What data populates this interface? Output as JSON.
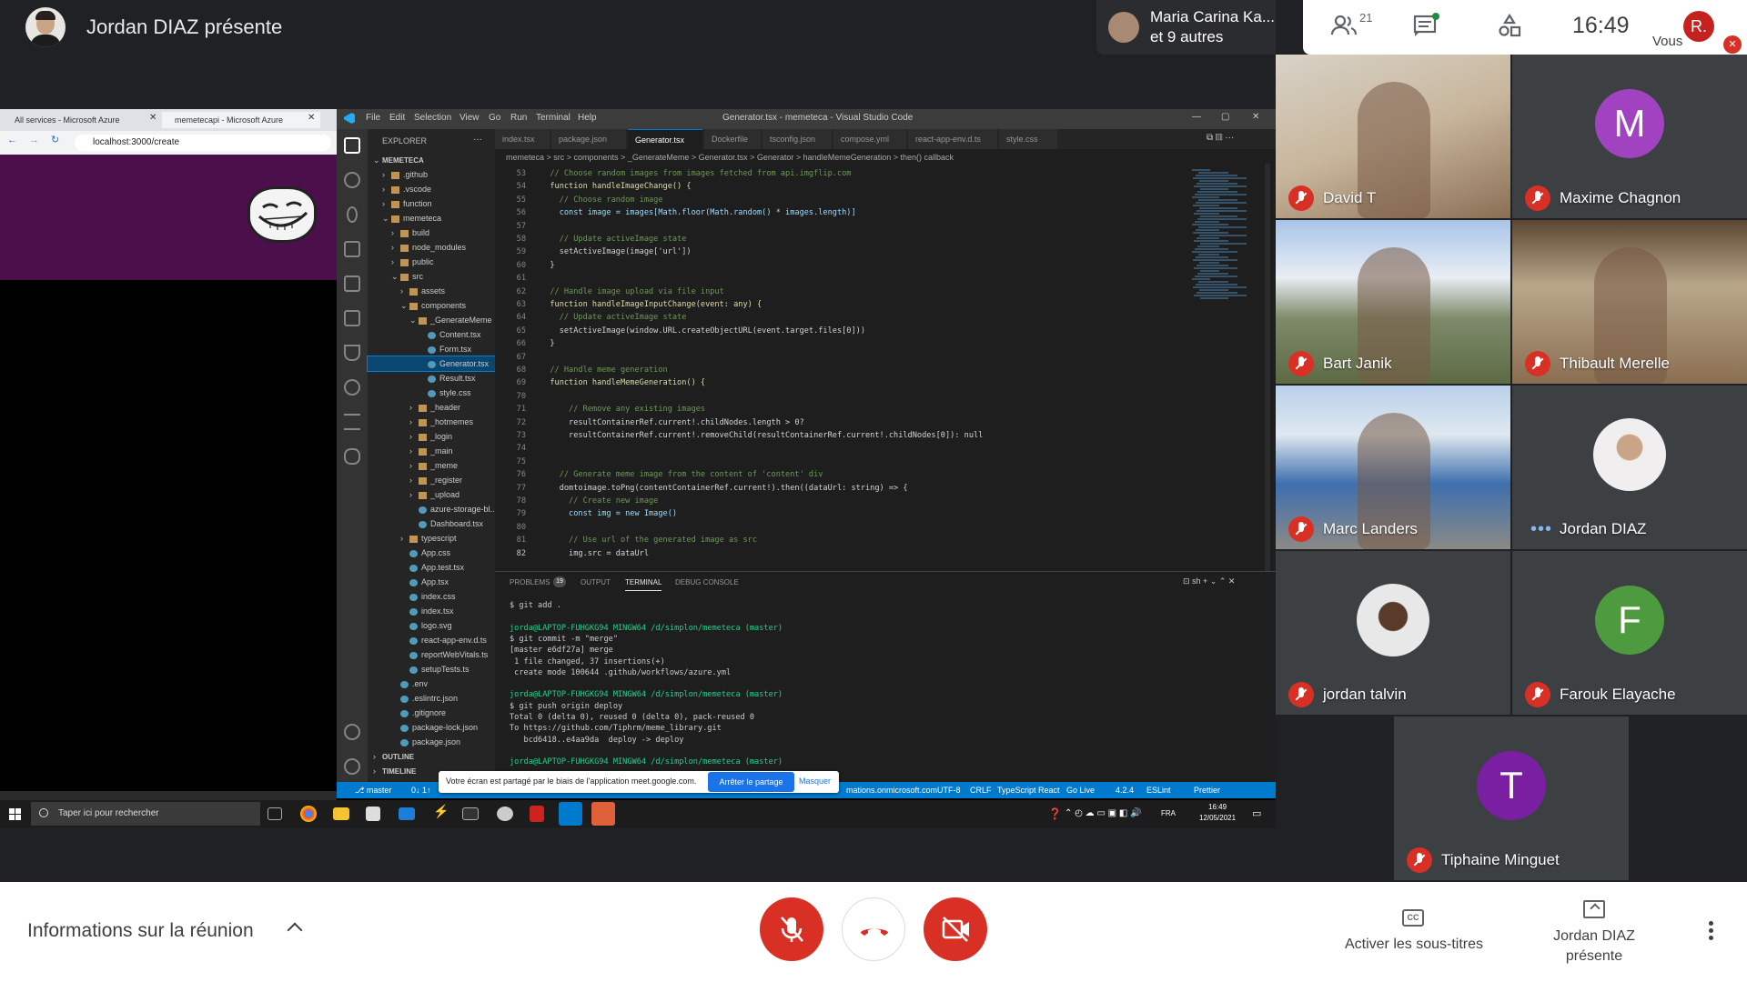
{
  "presenter": {
    "title": "Jordan DIAZ présente"
  },
  "notification": {
    "name": "Maria Carina Ka...",
    "others": "et 9 autres"
  },
  "top_controls": {
    "people_count": "21",
    "clock": "16:49",
    "self_initial": "R.",
    "self_label": "Vous"
  },
  "browser": {
    "tabs": [
      "All services - Microsoft Azure",
      "memetecapi - Microsoft Azure"
    ],
    "address": "localhost:3000/create"
  },
  "vscode": {
    "menu": [
      "File",
      "Edit",
      "Selection",
      "View",
      "Go",
      "Run",
      "Terminal",
      "Help"
    ],
    "window_title": "Generator.tsx - memeteca - Visual Studio Code",
    "explorer_label": "EXPLORER",
    "tree": [
      {
        "label": "MEMETECA",
        "depth": 0,
        "type": "root"
      },
      {
        "label": ".github",
        "depth": 1,
        "type": "folder"
      },
      {
        "label": ".vscode",
        "depth": 1,
        "type": "folder"
      },
      {
        "label": "function",
        "depth": 1,
        "type": "folder"
      },
      {
        "label": "memeteca",
        "depth": 1,
        "type": "folder-open"
      },
      {
        "label": "build",
        "depth": 2,
        "type": "folder"
      },
      {
        "label": "node_modules",
        "depth": 2,
        "type": "folder"
      },
      {
        "label": "public",
        "depth": 2,
        "type": "folder"
      },
      {
        "label": "src",
        "depth": 2,
        "type": "folder-open"
      },
      {
        "label": "assets",
        "depth": 3,
        "type": "folder"
      },
      {
        "label": "components",
        "depth": 3,
        "type": "folder-open"
      },
      {
        "label": "_GenerateMeme",
        "depth": 4,
        "type": "folder-open"
      },
      {
        "label": "Content.tsx",
        "depth": 5,
        "type": "file"
      },
      {
        "label": "Form.tsx",
        "depth": 5,
        "type": "file"
      },
      {
        "label": "Generator.tsx",
        "depth": 5,
        "type": "file-selected"
      },
      {
        "label": "Result.tsx",
        "depth": 5,
        "type": "file"
      },
      {
        "label": "style.css",
        "depth": 5,
        "type": "file"
      },
      {
        "label": "_header",
        "depth": 4,
        "type": "folder"
      },
      {
        "label": "_hotmemes",
        "depth": 4,
        "type": "folder"
      },
      {
        "label": "_login",
        "depth": 4,
        "type": "folder"
      },
      {
        "label": "_main",
        "depth": 4,
        "type": "folder"
      },
      {
        "label": "_meme",
        "depth": 4,
        "type": "folder"
      },
      {
        "label": "_register",
        "depth": 4,
        "type": "folder"
      },
      {
        "label": "_upload",
        "depth": 4,
        "type": "folder"
      },
      {
        "label": "azure-storage-bl...",
        "depth": 4,
        "type": "file"
      },
      {
        "label": "Dashboard.tsx",
        "depth": 4,
        "type": "file"
      },
      {
        "label": "typescript",
        "depth": 3,
        "type": "folder"
      },
      {
        "label": "App.css",
        "depth": 3,
        "type": "file"
      },
      {
        "label": "App.test.tsx",
        "depth": 3,
        "type": "file"
      },
      {
        "label": "App.tsx",
        "depth": 3,
        "type": "file"
      },
      {
        "label": "index.css",
        "depth": 3,
        "type": "file"
      },
      {
        "label": "index.tsx",
        "depth": 3,
        "type": "file"
      },
      {
        "label": "logo.svg",
        "depth": 3,
        "type": "file"
      },
      {
        "label": "react-app-env.d.ts",
        "depth": 3,
        "type": "file"
      },
      {
        "label": "reportWebVitals.ts",
        "depth": 3,
        "type": "file"
      },
      {
        "label": "setupTests.ts",
        "depth": 3,
        "type": "file"
      },
      {
        "label": ".env",
        "depth": 2,
        "type": "file"
      },
      {
        "label": ".eslintrc.json",
        "depth": 2,
        "type": "file"
      },
      {
        "label": ".gitignore",
        "depth": 2,
        "type": "file"
      },
      {
        "label": "package-lock.json",
        "depth": 2,
        "type": "file"
      },
      {
        "label": "package.json",
        "depth": 2,
        "type": "file"
      },
      {
        "label": "OUTLINE",
        "depth": 0,
        "type": "section"
      },
      {
        "label": "TIMELINE",
        "depth": 0,
        "type": "section"
      }
    ],
    "editor_tabs": [
      "index.tsx",
      "package.json",
      "Generator.tsx",
      "Dockerfile",
      "tsconfig.json",
      "compose.yml",
      "react-app-env.d.ts",
      "style.css"
    ],
    "active_tab": "Generator.tsx",
    "breadcrumb": "memeteca > src > components > _GenerateMeme > Generator.tsx > Generator > handleMemeGeneration > then() callback",
    "code": [
      {
        "n": "53",
        "t": "  // Choose random images from images fetched from api.imgflip.com"
      },
      {
        "n": "54",
        "t": "  function handleImageChange() {"
      },
      {
        "n": "55",
        "t": "    // Choose random image"
      },
      {
        "n": "56",
        "t": "    const image = images[Math.floor(Math.random() * images.length)]"
      },
      {
        "n": "57",
        "t": ""
      },
      {
        "n": "58",
        "t": "    // Update activeImage state"
      },
      {
        "n": "59",
        "t": "    setActiveImage(image['url'])"
      },
      {
        "n": "60",
        "t": "  }"
      },
      {
        "n": "61",
        "t": ""
      },
      {
        "n": "62",
        "t": "  // Handle image upload via file input"
      },
      {
        "n": "63",
        "t": "  function handleImageInputChange(event: any) {"
      },
      {
        "n": "64",
        "t": "    // Update activeImage state"
      },
      {
        "n": "65",
        "t": "    setActiveImage(window.URL.createObjectURL(event.target.files[0]))"
      },
      {
        "n": "66",
        "t": "  }"
      },
      {
        "n": "67",
        "t": ""
      },
      {
        "n": "68",
        "t": "  // Handle meme generation"
      },
      {
        "n": "69",
        "t": "  function handleMemeGeneration() {"
      },
      {
        "n": "70",
        "t": ""
      },
      {
        "n": "71",
        "t": "      // Remove any existing images"
      },
      {
        "n": "72",
        "t": "      resultContainerRef.current!.childNodes.length > 0?"
      },
      {
        "n": "73",
        "t": "      resultContainerRef.current!.removeChild(resultContainerRef.current!.childNodes[0]): null"
      },
      {
        "n": "74",
        "t": ""
      },
      {
        "n": "75",
        "t": ""
      },
      {
        "n": "76",
        "t": "    // Generate meme image from the content of 'content' div"
      },
      {
        "n": "77",
        "t": "    domtoimage.toPng(contentContainerRef.current!).then((dataUrl: string) => {"
      },
      {
        "n": "78",
        "t": "      // Create new image"
      },
      {
        "n": "79",
        "t": "      const img = new Image()"
      },
      {
        "n": "80",
        "t": ""
      },
      {
        "n": "81",
        "t": "      // Use url of the generated image as src"
      },
      {
        "n": "82",
        "t": "      img.src = dataUrl"
      }
    ],
    "panel_tabs": [
      "PROBLEMS",
      "OUTPUT",
      "TERMINAL",
      "DEBUG CONSOLE"
    ],
    "problems_count": "19",
    "active_panel_tab": "TERMINAL",
    "terminal": [
      {
        "t": "$ git add .",
        "k": "cmd"
      },
      {
        "t": "",
        "k": "blank"
      },
      {
        "t": "jorda@LAPTOP-FUHGKG94 MINGW64 /d/simplon/memeteca (master)",
        "k": "prompt"
      },
      {
        "t": "$ git commit -m \"merge\"",
        "k": "cmd"
      },
      {
        "t": "[master e6df27a] merge",
        "k": "out"
      },
      {
        "t": " 1 file changed, 37 insertions(+)",
        "k": "out"
      },
      {
        "t": " create mode 100644 .github/workflows/azure.yml",
        "k": "out"
      },
      {
        "t": "",
        "k": "blank"
      },
      {
        "t": "jorda@LAPTOP-FUHGKG94 MINGW64 /d/simplon/memeteca (master)",
        "k": "prompt"
      },
      {
        "t": "$ git push origin deploy",
        "k": "cmd"
      },
      {
        "t": "Total 0 (delta 0), reused 0 (delta 0), pack-reused 0",
        "k": "out"
      },
      {
        "t": "To https://github.com/Tiphrm/meme_library.git",
        "k": "out"
      },
      {
        "t": "   bcd6418..e4aa9da  deploy -> deploy",
        "k": "out"
      },
      {
        "t": "",
        "k": "blank"
      },
      {
        "t": "jorda@LAPTOP-FUHGKG94 MINGW64 /d/simplon/memeteca (master)",
        "k": "prompt"
      }
    ],
    "status": {
      "branch": "master",
      "sync": "0↓ 1↑",
      "right": [
        "mations.onmicrosoft.com",
        "UTF-8",
        "CRLF",
        "TypeScript React",
        "Go Live",
        "4.2.4",
        "ESLint",
        "Prettier"
      ]
    }
  },
  "share_banner": {
    "message": "Votre écran est partagé par le biais de l'application meet.google.com.",
    "stop_label": "Arrêter le partage",
    "hide_label": "Masquer"
  },
  "taskbar": {
    "search_placeholder": "Taper ici pour rechercher",
    "lang": "FRA",
    "time": "16:49",
    "date": "12/05/2021"
  },
  "participants": [
    {
      "name": "David T",
      "kind": "video",
      "muted": true
    },
    {
      "name": "Maxime Chagnon",
      "kind": "letter",
      "letter": "M",
      "color": "#a142c0",
      "muted": true
    },
    {
      "name": "Bart Janik",
      "kind": "video",
      "muted": true
    },
    {
      "name": "Thibault Merelle",
      "kind": "video",
      "muted": true
    },
    {
      "name": "Marc Landers",
      "kind": "video",
      "muted": true
    },
    {
      "name": "Jordan DIAZ",
      "kind": "photo",
      "muted": false
    },
    {
      "name": "jordan talvin",
      "kind": "photo",
      "muted": true
    },
    {
      "name": "Farouk Elayache",
      "kind": "letter",
      "letter": "F",
      "color": "#4e9a3e",
      "muted": true
    },
    {
      "name": "Tiphaine Minguet",
      "kind": "letter",
      "letter": "T",
      "color": "#7b1fa2",
      "muted": true
    }
  ],
  "bottom": {
    "meeting_info": "Informations sur la réunion",
    "captions_label": "Activer les sous-titres",
    "present_label_1": "Jordan DIAZ",
    "present_label_2": "présente"
  },
  "colors": {
    "mic_off": "#d93025",
    "hangup": "#ffffff",
    "accent": "#1a73e8"
  }
}
